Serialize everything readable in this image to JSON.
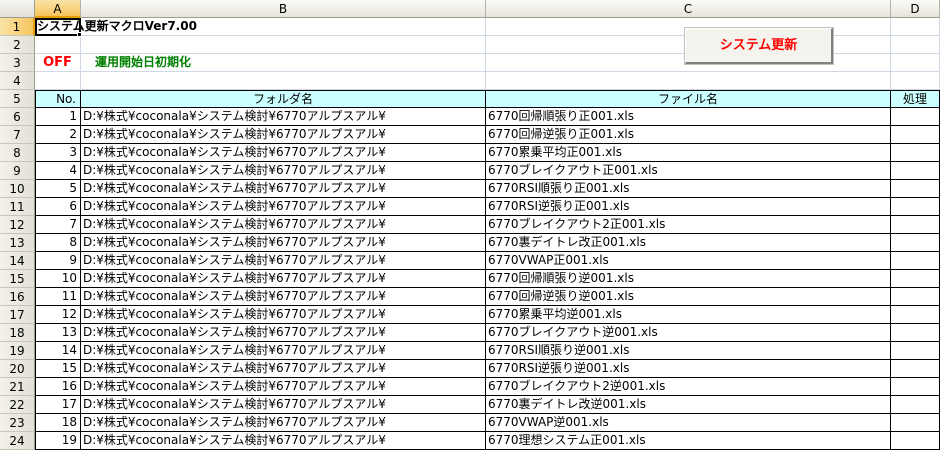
{
  "columns": [
    "A",
    "B",
    "C",
    "D"
  ],
  "rows": [
    "1",
    "2",
    "3",
    "4",
    "5",
    "6",
    "7",
    "8",
    "9",
    "10",
    "11",
    "12",
    "13",
    "14",
    "15",
    "16",
    "17",
    "18",
    "19",
    "20",
    "21",
    "22",
    "23",
    "24"
  ],
  "title": "システム更新マクロVer7.00",
  "status_off": "OFF",
  "init_label": "運用開始日初期化",
  "update_button": "システム更新",
  "table_headers": {
    "no": "No.",
    "folder": "フォルダ名",
    "file": "ファイル名",
    "process": "処理"
  },
  "table_rows": [
    {
      "no": "1",
      "folder": "D:¥株式¥coconala¥システム検討¥6770アルプスアル¥",
      "file": "6770回帰順張り正001.xls"
    },
    {
      "no": "2",
      "folder": "D:¥株式¥coconala¥システム検討¥6770アルプスアル¥",
      "file": "6770回帰逆張り正001.xls"
    },
    {
      "no": "3",
      "folder": "D:¥株式¥coconala¥システム検討¥6770アルプスアル¥",
      "file": "6770累乗平均正001.xls"
    },
    {
      "no": "4",
      "folder": "D:¥株式¥coconala¥システム検討¥6770アルプスアル¥",
      "file": "6770ブレイクアウト正001.xls"
    },
    {
      "no": "5",
      "folder": "D:¥株式¥coconala¥システム検討¥6770アルプスアル¥",
      "file": "6770RSI順張り正001.xls"
    },
    {
      "no": "6",
      "folder": "D:¥株式¥coconala¥システム検討¥6770アルプスアル¥",
      "file": "6770RSI逆張り正001.xls"
    },
    {
      "no": "7",
      "folder": "D:¥株式¥coconala¥システム検討¥6770アルプスアル¥",
      "file": "6770ブレイクアウト2正001.xls"
    },
    {
      "no": "8",
      "folder": "D:¥株式¥coconala¥システム検討¥6770アルプスアル¥",
      "file": "6770裏デイトレ改正001.xls"
    },
    {
      "no": "9",
      "folder": "D:¥株式¥coconala¥システム検討¥6770アルプスアル¥",
      "file": "6770VWAP正001.xls"
    },
    {
      "no": "10",
      "folder": "D:¥株式¥coconala¥システム検討¥6770アルプスアル¥",
      "file": "6770回帰順張り逆001.xls"
    },
    {
      "no": "11",
      "folder": "D:¥株式¥coconala¥システム検討¥6770アルプスアル¥",
      "file": "6770回帰逆張り逆001.xls"
    },
    {
      "no": "12",
      "folder": "D:¥株式¥coconala¥システム検討¥6770アルプスアル¥",
      "file": "6770累乗平均逆001.xls"
    },
    {
      "no": "13",
      "folder": "D:¥株式¥coconala¥システム検討¥6770アルプスアル¥",
      "file": "6770ブレイクアウト逆001.xls"
    },
    {
      "no": "14",
      "folder": "D:¥株式¥coconala¥システム検討¥6770アルプスアル¥",
      "file": "6770RSI順張り逆001.xls"
    },
    {
      "no": "15",
      "folder": "D:¥株式¥coconala¥システム検討¥6770アルプスアル¥",
      "file": "6770RSI逆張り逆001.xls"
    },
    {
      "no": "16",
      "folder": "D:¥株式¥coconala¥システム検討¥6770アルプスアル¥",
      "file": "6770ブレイクアウト2逆001.xls"
    },
    {
      "no": "17",
      "folder": "D:¥株式¥coconala¥システム検討¥6770アルプスアル¥",
      "file": "6770裏デイトレ改逆001.xls"
    },
    {
      "no": "18",
      "folder": "D:¥株式¥coconala¥システム検討¥6770アルプスアル¥",
      "file": "6770VWAP逆001.xls"
    },
    {
      "no": "19",
      "folder": "D:¥株式¥coconala¥システム検討¥6770アルプスアル¥",
      "file": "6770理想システム正001.xls"
    }
  ],
  "colors": {
    "header_fill": "#ccffff",
    "selected_header": "#f6c65f",
    "red_text": "#ff0000",
    "green_text": "#008000"
  }
}
